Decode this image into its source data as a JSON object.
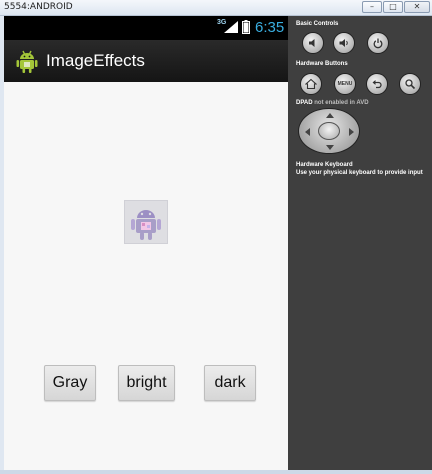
{
  "window": {
    "title": "5554:ANDROID",
    "minimize_glyph": "–",
    "maximize_glyph": "□",
    "close_glyph": "✕"
  },
  "status_bar": {
    "network": "3G",
    "time": "6:35",
    "icons": [
      "signal-icon",
      "battery-icon"
    ],
    "time_color": "#3aaee0"
  },
  "action_bar": {
    "app_icon": "android-robot-icon",
    "title": "ImageEffects"
  },
  "content": {
    "image": "android-robot-image",
    "buttons": {
      "gray": "Gray",
      "bright": "bright",
      "dark": "dark"
    }
  },
  "controls": {
    "basic_controls_label": "Basic Controls",
    "basic_buttons": [
      "volume-down-icon",
      "volume-up-icon",
      "power-icon"
    ],
    "hardware_buttons_label": "Hardware Buttons",
    "hardware_buttons": [
      "home-icon",
      "menu-button",
      "back-icon",
      "search-icon"
    ],
    "menu_label": "MENU",
    "dpad_label_bold": "DPAD",
    "dpad_label_rest": "not enabled in AVD",
    "keyboard_label": "Hardware Keyboard",
    "keyboard_hint": "Use your physical keyboard to provide input"
  }
}
